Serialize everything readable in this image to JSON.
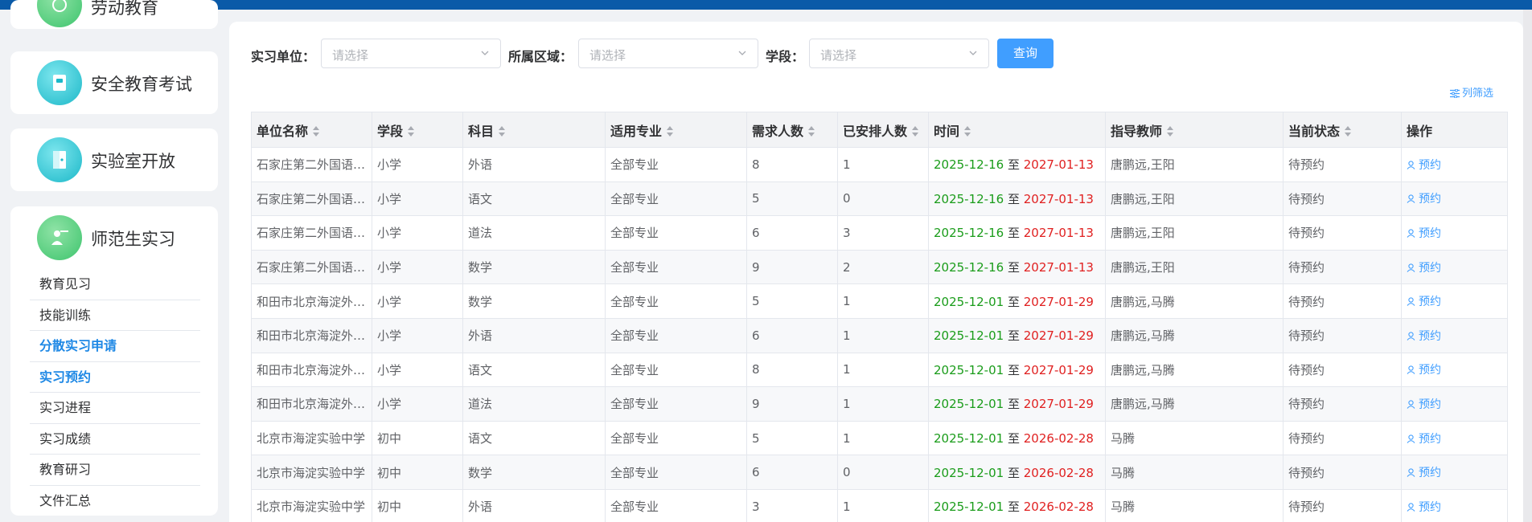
{
  "colors": {
    "accent": "#409eff",
    "topbar": "#0a5aa8",
    "start_date": "#1a9c1a",
    "end_date": "#e02020",
    "active_menu": "#1e88e5"
  },
  "sidebar": {
    "cards": [
      {
        "title": "劳动教育",
        "icon": "brush-icon"
      },
      {
        "title": "安全教育考试",
        "icon": "book-icon"
      },
      {
        "title": "实验室开放",
        "icon": "door-icon"
      },
      {
        "title": "师范生实习",
        "icon": "teacher-icon"
      }
    ],
    "submenu": [
      {
        "label": "教育见习",
        "active": false
      },
      {
        "label": "技能训练",
        "active": false
      },
      {
        "label": "分散实习申请",
        "active": true
      },
      {
        "label": "实习预约",
        "active": true
      },
      {
        "label": "实习进程",
        "active": false
      },
      {
        "label": "实习成绩",
        "active": false
      },
      {
        "label": "教育研习",
        "active": false
      },
      {
        "label": "文件汇总",
        "active": false
      }
    ]
  },
  "filters": {
    "unit_label": "实习单位：",
    "unit_placeholder": "请选择",
    "region_label": "所属区域：",
    "region_placeholder": "请选择",
    "stage_label": "学段：",
    "stage_placeholder": "请选择",
    "query_button": "查询",
    "column_filter": "列筛选"
  },
  "table": {
    "headers": [
      "单位名称",
      "学段",
      "科目",
      "适用专业",
      "需求人数",
      "已安排人数",
      "时间",
      "指导教师",
      "当前状态",
      "操作"
    ],
    "date_separator": "至",
    "action_label": "预约",
    "rows": [
      {
        "unit": "石家庄第二外国语学校",
        "stage": "小学",
        "subject": "外语",
        "major": "全部专业",
        "need": "8",
        "arranged": "1",
        "start": "2025-12-16",
        "end": "2027-01-13",
        "teacher": "唐鹏远,王阳",
        "status": "待预约"
      },
      {
        "unit": "石家庄第二外国语学校",
        "stage": "小学",
        "subject": "语文",
        "major": "全部专业",
        "need": "5",
        "arranged": "0",
        "start": "2025-12-16",
        "end": "2027-01-13",
        "teacher": "唐鹏远,王阳",
        "status": "待预约"
      },
      {
        "unit": "石家庄第二外国语学校",
        "stage": "小学",
        "subject": "道法",
        "major": "全部专业",
        "need": "6",
        "arranged": "3",
        "start": "2025-12-16",
        "end": "2027-01-13",
        "teacher": "唐鹏远,王阳",
        "status": "待预约"
      },
      {
        "unit": "石家庄第二外国语学校",
        "stage": "小学",
        "subject": "数学",
        "major": "全部专业",
        "need": "9",
        "arranged": "2",
        "start": "2025-12-16",
        "end": "2027-01-13",
        "teacher": "唐鹏远,王阳",
        "status": "待预约"
      },
      {
        "unit": "和田市北京海淀外国语学校",
        "stage": "小学",
        "subject": "数学",
        "major": "全部专业",
        "need": "5",
        "arranged": "1",
        "start": "2025-12-01",
        "end": "2027-01-29",
        "teacher": "唐鹏远,马腾",
        "status": "待预约"
      },
      {
        "unit": "和田市北京海淀外国语学校",
        "stage": "小学",
        "subject": "外语",
        "major": "全部专业",
        "need": "6",
        "arranged": "1",
        "start": "2025-12-01",
        "end": "2027-01-29",
        "teacher": "唐鹏远,马腾",
        "status": "待预约"
      },
      {
        "unit": "和田市北京海淀外国语学校",
        "stage": "小学",
        "subject": "语文",
        "major": "全部专业",
        "need": "8",
        "arranged": "1",
        "start": "2025-12-01",
        "end": "2027-01-29",
        "teacher": "唐鹏远,马腾",
        "status": "待预约"
      },
      {
        "unit": "和田市北京海淀外国语学校",
        "stage": "小学",
        "subject": "道法",
        "major": "全部专业",
        "need": "9",
        "arranged": "1",
        "start": "2025-12-01",
        "end": "2027-01-29",
        "teacher": "唐鹏远,马腾",
        "status": "待预约"
      },
      {
        "unit": "北京市海淀实验中学",
        "stage": "初中",
        "subject": "语文",
        "major": "全部专业",
        "need": "5",
        "arranged": "1",
        "start": "2025-12-01",
        "end": "2026-02-28",
        "teacher": "马腾",
        "status": "待预约"
      },
      {
        "unit": "北京市海淀实验中学",
        "stage": "初中",
        "subject": "数学",
        "major": "全部专业",
        "need": "6",
        "arranged": "0",
        "start": "2025-12-01",
        "end": "2026-02-28",
        "teacher": "马腾",
        "status": "待预约"
      },
      {
        "unit": "北京市海淀实验中学",
        "stage": "初中",
        "subject": "外语",
        "major": "全部专业",
        "need": "3",
        "arranged": "1",
        "start": "2025-12-01",
        "end": "2026-02-28",
        "teacher": "马腾",
        "status": "待预约"
      }
    ]
  }
}
